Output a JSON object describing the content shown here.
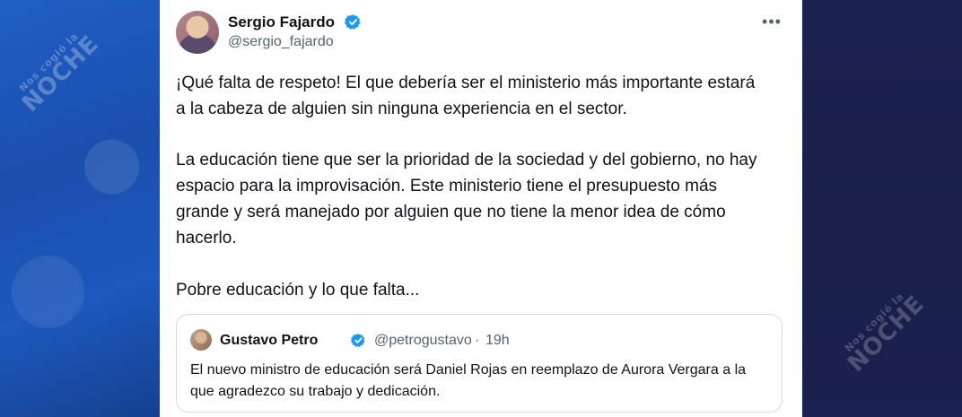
{
  "watermark": {
    "top": "Nos cogió la",
    "main": "NOCHE"
  },
  "tweet": {
    "author": {
      "name": "Sergio Fajardo",
      "handle": "@sergio_fajardo"
    },
    "more_icon": "more-options-icon",
    "paragraphs": [
      "¡Qué falta de respeto! El que debería ser el ministerio más importante estará a la cabeza de alguien sin ninguna experiencia en el sector.",
      "La educación tiene que ser la prioridad de la sociedad y del gobierno, no hay espacio para la improvisación. Este ministerio tiene el presupuesto más grande y será manejado por alguien que no tiene la menor idea de cómo hacerlo.",
      "Pobre educación y lo que falta..."
    ],
    "quoted": {
      "name": "Gustavo Petro",
      "handle": "@petrogustavo",
      "separator": "·",
      "time": "19h",
      "text": "El nuevo ministro de educación será Daniel Rojas en reemplazo de Aurora Vergara a la que agradezco su trabajo y dedicación."
    }
  },
  "colors": {
    "verified": "#1d9bf0",
    "text": "#0f1419",
    "secondary": "#536471",
    "border": "#cfd9de"
  }
}
